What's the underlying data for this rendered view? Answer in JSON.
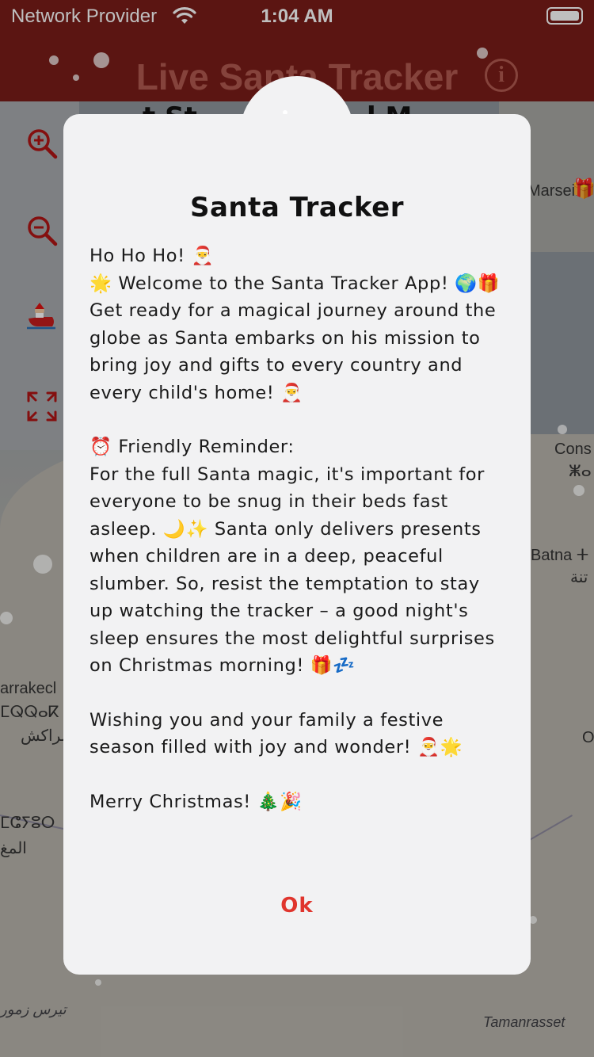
{
  "status_bar": {
    "carrier": "Network Provider",
    "time": "1:04 AM"
  },
  "app": {
    "title": "Live Santa Tracker",
    "info_icon": "info-circle-icon"
  },
  "map": {
    "labels": [
      "Marseil",
      "Cons",
      "ⵥⴰ",
      "Batna ⵜ",
      "تنة",
      "arrakecl",
      "ⵎⵕⵕⴰⴽ",
      "مراكش",
      "ⵎⵛⵢⵓⵔ",
      "المغ",
      "تيرس زمور",
      "Tamanrasset",
      "O"
    ]
  },
  "controls": [
    {
      "icon": "zoom-in-icon"
    },
    {
      "icon": "zoom-out-icon"
    },
    {
      "icon": "santa-sleigh-icon"
    },
    {
      "icon": "expand-arrows-icon"
    }
  ],
  "dialog": {
    "badge_icon": "santa-sleigh-reindeer-icon",
    "title": "Santa Tracker",
    "paragraphs": [
      "Ho Ho Ho! 🎅\n🌟 Welcome to the Santa Tracker App! 🌍🎁\nGet ready for a magical journey around the globe as Santa embarks on his mission to bring joy and gifts to every country and every child's home! 🎅",
      "⏰ Friendly Reminder:\nFor the full Santa magic, it's important for everyone to be snug in their beds fast asleep. 🌙✨ Santa only delivers presents when children are in a deep, peaceful slumber. So, resist the temptation to stay up watching the tracker – a good night's sleep ensures the most delightful surprises on Christmas morning! 🎁💤",
      "Wishing you and your family a festive season filled with joy and wonder! 🎅🌟",
      "Merry Christmas! 🎄🎉"
    ],
    "ok_label": "Ok"
  },
  "colors": {
    "header_bg": "#7a1d18",
    "accent_red": "#e0352d",
    "dialog_bg": "#f2f2f3",
    "control_red": "#b01515"
  }
}
